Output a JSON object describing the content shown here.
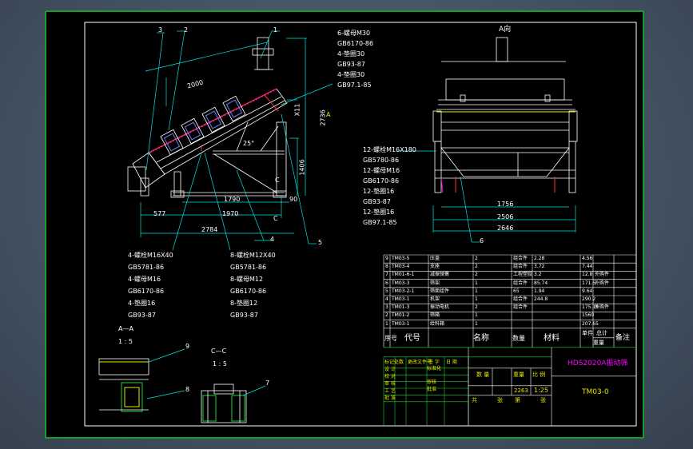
{
  "view_labels": {
    "view_a": "A向",
    "arrow_a": "A",
    "section_aa": "A—A",
    "scale_aa": "1 : 5",
    "section_cc": "C—C",
    "scale_cc": "1 : 5",
    "mark_c": "C",
    "mark_c2": "C"
  },
  "dimensions": {
    "d2000": "2000",
    "d2736": "2736",
    "dx11": "X11",
    "d1406": "1406",
    "d1790": "1790",
    "d90": "90",
    "d577": "577",
    "d1970": "1970",
    "d2784": "2784",
    "d25": "25°",
    "d1756": "1756",
    "d2506": "2506",
    "d2646": "2646"
  },
  "balloons": {
    "b1": "1",
    "b2": "2",
    "b3": "3",
    "b4": "4",
    "b5": "5",
    "b6": "6",
    "b7": "7",
    "b8": "8",
    "b9": "9"
  },
  "callouts": {
    "top_right": [
      "6-螺母M30",
      "GB6170-86",
      "4-垫圈30",
      "GB93-87",
      "4-垫圈30",
      "GB97.1-85"
    ],
    "front_left": [
      "12-螺栓M16X180",
      "GB5780-86",
      "12-螺母M16",
      "GB6170-86",
      "12-垫圈16",
      "GB93-87",
      "12-垫圈16",
      "GB97.1-85"
    ],
    "bottom_left": [
      "4-螺栓M16X40",
      "GB5781-86",
      "4-螺母M16",
      "GB6170-86",
      "4-垫圈16",
      "GB93-87"
    ],
    "bottom_mid": [
      "8-螺栓M12X40",
      "GB5781-86",
      "8-螺母M12",
      "GB6170-86",
      "8-垫圈12",
      "GB93-87"
    ]
  },
  "bom": {
    "rows": [
      [
        "9",
        "TM03-5",
        "压盖",
        "2",
        "组合件",
        "2.28",
        "4.56",
        ""
      ],
      [
        "8",
        "TM03-4",
        "支座",
        "2",
        "组合件",
        "3.72",
        "7.44",
        ""
      ],
      [
        "7",
        "TM01-6-1",
        "减振弹簧",
        "2",
        "工程塑胶",
        "3.2",
        "12.8",
        "外购件"
      ],
      [
        "6",
        "TM03-3",
        "筛架",
        "1",
        "组合件",
        "85.74",
        "171.5",
        "外购件"
      ],
      [
        "5",
        "TM03-2-1",
        "筛面组件",
        "1",
        "65",
        "1.94",
        "9.64",
        ""
      ],
      [
        "4",
        "TM03-1",
        "机架",
        "1",
        "组合件",
        "244.8",
        "290.2",
        ""
      ],
      [
        "3",
        "TM01-3",
        "振动电机",
        "2",
        "组合件",
        "",
        "175.18",
        "外购件"
      ],
      [
        "2",
        "TM01-2",
        "筛箱",
        "1",
        "",
        "",
        "1560",
        ""
      ],
      [
        "1",
        "TM03-1",
        "给料箱",
        "1",
        "",
        "",
        "207.65",
        ""
      ]
    ],
    "header": {
      "seq": "序号",
      "code": "代号",
      "name": "名称",
      "qty": "数量",
      "material": "材料",
      "unit_weight": "单件",
      "total_weight": "总计",
      "weight": "重量",
      "remark": "备注"
    }
  },
  "title_block": {
    "product": "HDS2020A振动筛",
    "drawing_no": "TM03-0",
    "weight_value": "2263",
    "scale_value": "1:25",
    "stage_label": "数 量",
    "weight_label": "重量",
    "scale_label": "比 例",
    "sheet_total": "共",
    "sheet_label": "张",
    "sheet_no": "第",
    "sheet_label2": "张",
    "rows": [
      "标记处数",
      "设 计",
      "校 对",
      "审 核",
      "工 艺",
      "批 准"
    ],
    "cols": [
      "更改文件号",
      "签 字",
      "日 期"
    ],
    "std1": "标准化",
    "std2": "审核",
    "std3": "批准"
  }
}
